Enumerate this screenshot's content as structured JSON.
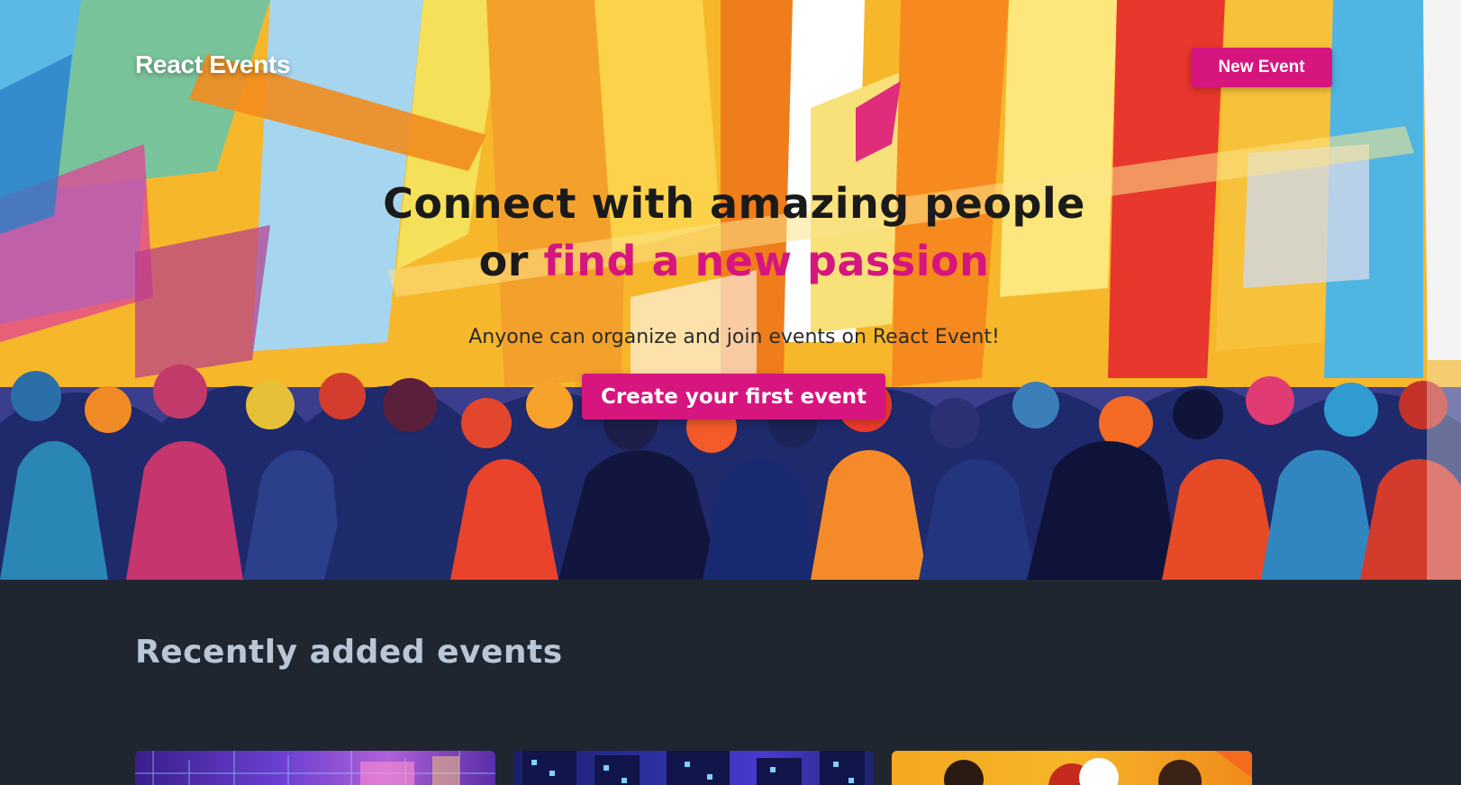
{
  "header": {
    "brand": "React Events",
    "new_event_label": "New Event"
  },
  "hero": {
    "headline_line1": "Connect with amazing people",
    "headline_line2_prefix": "or ",
    "headline_line2_accent": "find a new passion",
    "subtitle": "Anyone can organize and join events on React Event!",
    "cta_label": "Create your first event"
  },
  "recent": {
    "title": "Recently added events",
    "cards": [
      {
        "illustration": "neon-tech-art"
      },
      {
        "illustration": "night-city-art"
      },
      {
        "illustration": "people-illustration"
      }
    ]
  },
  "colors": {
    "accent": "#d6157f",
    "dark_background": "#1f2630",
    "section_title": "#b9c6d6"
  }
}
